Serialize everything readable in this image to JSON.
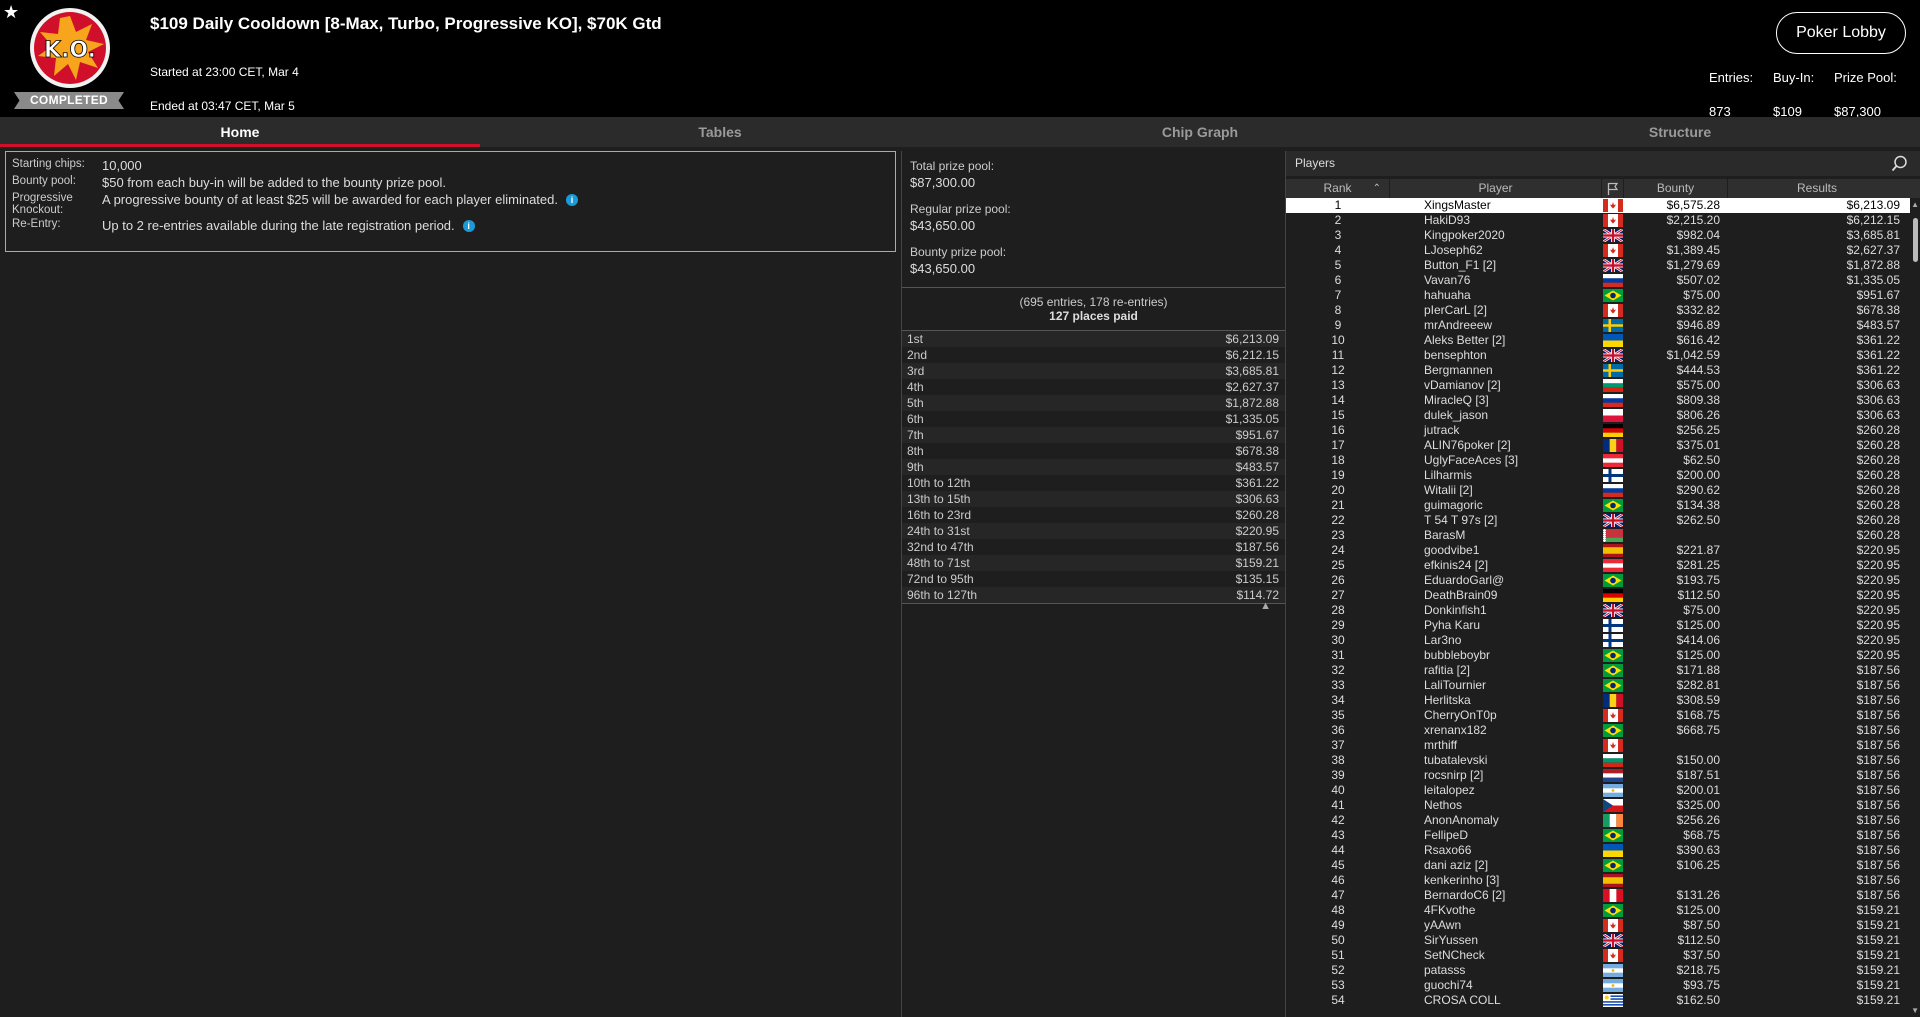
{
  "header": {
    "title": "$109 Daily Cooldown [8-Max, Turbo, Progressive KO], $70K Gtd",
    "started": "Started at 23:00 CET, Mar 4",
    "ended": "Ended at 03:47 CET, Mar 5",
    "logo_text": "K.O.",
    "status_badge": "COMPLETED",
    "lobby_button": "Poker Lobby",
    "stats": {
      "entries_label": "Entries:",
      "entries_value": "873",
      "buyin_label": "Buy-In:",
      "buyin_value": "$109",
      "prize_label": "Prize Pool:",
      "prize_value": "$87,300"
    }
  },
  "tabs": [
    {
      "label": "Home",
      "active": true
    },
    {
      "label": "Tables",
      "active": false
    },
    {
      "label": "Chip Graph",
      "active": false
    },
    {
      "label": "Structure",
      "active": false
    }
  ],
  "info": [
    {
      "key": "Starting chips:",
      "value": "10,000",
      "icon": false
    },
    {
      "key": "Bounty pool:",
      "value": "$50 from each buy-in will be added to the bounty prize pool.",
      "icon": false
    },
    {
      "key": "Progressive Knockout:",
      "value": "A progressive bounty of at least $25 will be awarded for each player eliminated.",
      "icon": true
    },
    {
      "key": "Re-Entry:",
      "value": "Up to 2 re-entries available during the late registration period.",
      "icon": true
    }
  ],
  "prize": {
    "total_label": "Total prize pool:",
    "total_value": "$87,300.00",
    "regular_label": "Regular prize pool:",
    "regular_value": "$43,650.00",
    "bounty_label": "Bounty prize pool:",
    "bounty_value": "$43,650.00",
    "entries_note": "(695 entries, 178 re-entries)",
    "places_paid": "127 places paid",
    "payouts": [
      [
        "1st",
        "$6,213.09"
      ],
      [
        "2nd",
        "$6,212.15"
      ],
      [
        "3rd",
        "$3,685.81"
      ],
      [
        "4th",
        "$2,627.37"
      ],
      [
        "5th",
        "$1,872.88"
      ],
      [
        "6th",
        "$1,335.05"
      ],
      [
        "7th",
        "$951.67"
      ],
      [
        "8th",
        "$678.38"
      ],
      [
        "9th",
        "$483.57"
      ],
      [
        "10th to 12th",
        "$361.22"
      ],
      [
        "13th to 15th",
        "$306.63"
      ],
      [
        "16th to 23rd",
        "$260.28"
      ],
      [
        "24th to 31st",
        "$220.95"
      ],
      [
        "32nd to 47th",
        "$187.56"
      ],
      [
        "48th to 71st",
        "$159.21"
      ],
      [
        "72nd to 95th",
        "$135.15"
      ],
      [
        "96th to 127th",
        "$114.72"
      ]
    ]
  },
  "players": {
    "title": "Players",
    "columns": {
      "rank": "Rank",
      "player": "Player",
      "bounty": "Bounty",
      "results": "Results"
    },
    "rows": [
      [
        "1",
        "XingsMaster",
        "$6,575.28",
        "$6,213.09",
        "ca"
      ],
      [
        "2",
        "HakiD93",
        "$2,215.20",
        "$6,212.15",
        "ca"
      ],
      [
        "3",
        "Kingpoker2020",
        "$982.04",
        "$3,685.81",
        "gb"
      ],
      [
        "4",
        "LJoseph62",
        "$1,389.45",
        "$2,627.37",
        "ca"
      ],
      [
        "5",
        "Button_F1 [2]",
        "$1,279.69",
        "$1,872.88",
        "gb"
      ],
      [
        "6",
        "Vavan76",
        "$507.02",
        "$1,335.05",
        "ru"
      ],
      [
        "7",
        "hahuaha",
        "$75.00",
        "$951.67",
        "br"
      ],
      [
        "8",
        "pIerCarL [2]",
        "$332.82",
        "$678.38",
        "ca"
      ],
      [
        "9",
        "mrAndreeew",
        "$946.89",
        "$483.57",
        "se"
      ],
      [
        "10",
        "Aleks Better [2]",
        "$616.42",
        "$361.22",
        "ua"
      ],
      [
        "11",
        "bensephton",
        "$1,042.59",
        "$361.22",
        "gb"
      ],
      [
        "12",
        "Bergmannen",
        "$444.53",
        "$361.22",
        "se"
      ],
      [
        "13",
        "vDamianov [2]",
        "$575.00",
        "$306.63",
        "bg"
      ],
      [
        "14",
        "MiracleQ [3]",
        "$809.38",
        "$306.63",
        "ru"
      ],
      [
        "15",
        "dulek_jason",
        "$806.26",
        "$306.63",
        "pl"
      ],
      [
        "16",
        "jutrack",
        "$256.25",
        "$260.28",
        "de"
      ],
      [
        "17",
        "ALIN76poker [2]",
        "$375.01",
        "$260.28",
        "ro"
      ],
      [
        "18",
        "UglyFaceAces [3]",
        "$62.50",
        "$260.28",
        "at"
      ],
      [
        "19",
        "Lilharmis",
        "$200.00",
        "$260.28",
        "fi"
      ],
      [
        "20",
        "Witalii [2]",
        "$290.62",
        "$260.28",
        "ru"
      ],
      [
        "21",
        "guimagoric",
        "$134.38",
        "$260.28",
        "br"
      ],
      [
        "22",
        "T 54 T 97s [2]",
        "$262.50",
        "$260.28",
        "gb"
      ],
      [
        "23",
        "BarasM",
        "",
        "$260.28",
        "by"
      ],
      [
        "24",
        "goodvibe1",
        "$221.87",
        "$220.95",
        "es"
      ],
      [
        "25",
        "efkinis24 [2]",
        "$281.25",
        "$220.95",
        "at"
      ],
      [
        "26",
        "EduardoGarl@",
        "$193.75",
        "$220.95",
        "br"
      ],
      [
        "27",
        "DeathBrain09",
        "$112.50",
        "$220.95",
        "de"
      ],
      [
        "28",
        "Donkinfish1",
        "$75.00",
        "$220.95",
        "gb"
      ],
      [
        "29",
        "Pyha Karu",
        "$125.00",
        "$220.95",
        "fi"
      ],
      [
        "30",
        "Lar3no",
        "$414.06",
        "$220.95",
        "fi"
      ],
      [
        "31",
        "bubbleboybr",
        "$125.00",
        "$220.95",
        "br"
      ],
      [
        "32",
        "rafitia [2]",
        "$171.88",
        "$187.56",
        "br"
      ],
      [
        "33",
        "LaliTournier",
        "$282.81",
        "$187.56",
        "br"
      ],
      [
        "34",
        "Herlitska",
        "$308.59",
        "$187.56",
        "ro"
      ],
      [
        "35",
        "CherryOnT0p",
        "$168.75",
        "$187.56",
        "ca"
      ],
      [
        "36",
        "xrenanx182",
        "$668.75",
        "$187.56",
        "br"
      ],
      [
        "37",
        "mrthiff",
        "",
        "$187.56",
        "ca"
      ],
      [
        "38",
        "tubatalevski",
        "$150.00",
        "$187.56",
        "bg"
      ],
      [
        "39",
        "rocsnirp [2]",
        "$187.51",
        "$187.56",
        "nl"
      ],
      [
        "40",
        "leitalopez",
        "$200.01",
        "$187.56",
        "ar"
      ],
      [
        "41",
        "Nethos",
        "$325.00",
        "$187.56",
        "cz"
      ],
      [
        "42",
        "AnonAnomaly",
        "$256.26",
        "$187.56",
        "ie"
      ],
      [
        "43",
        "FellipeD",
        "$68.75",
        "$187.56",
        "br"
      ],
      [
        "44",
        "Rsaxo66",
        "$390.63",
        "$187.56",
        "ua"
      ],
      [
        "45",
        "dani aziz [2]",
        "$106.25",
        "$187.56",
        "br"
      ],
      [
        "46",
        "kenkerinho [3]",
        "",
        "$187.56",
        "es"
      ],
      [
        "47",
        "BernardoC6 [2]",
        "$131.26",
        "$187.56",
        "pe"
      ],
      [
        "48",
        "4FKvothe",
        "$125.00",
        "$159.21",
        "br"
      ],
      [
        "49",
        "yAAwn",
        "$87.50",
        "$159.21",
        "ca"
      ],
      [
        "50",
        "SirYussen",
        "$112.50",
        "$159.21",
        "gb"
      ],
      [
        "51",
        "SetNCheck",
        "$37.50",
        "$159.21",
        "ca"
      ],
      [
        "52",
        "patasss",
        "$218.75",
        "$159.21",
        "ar"
      ],
      [
        "53",
        "guochi74",
        "$93.75",
        "$159.21",
        "ar"
      ],
      [
        "54",
        "CROSA COLL",
        "$162.50",
        "$159.21",
        "uy"
      ]
    ]
  },
  "colors": {
    "accent": "#d0102a",
    "info_icon": "#1a9bd7",
    "background": "#1e1e1e",
    "header_bg": "#000000"
  }
}
